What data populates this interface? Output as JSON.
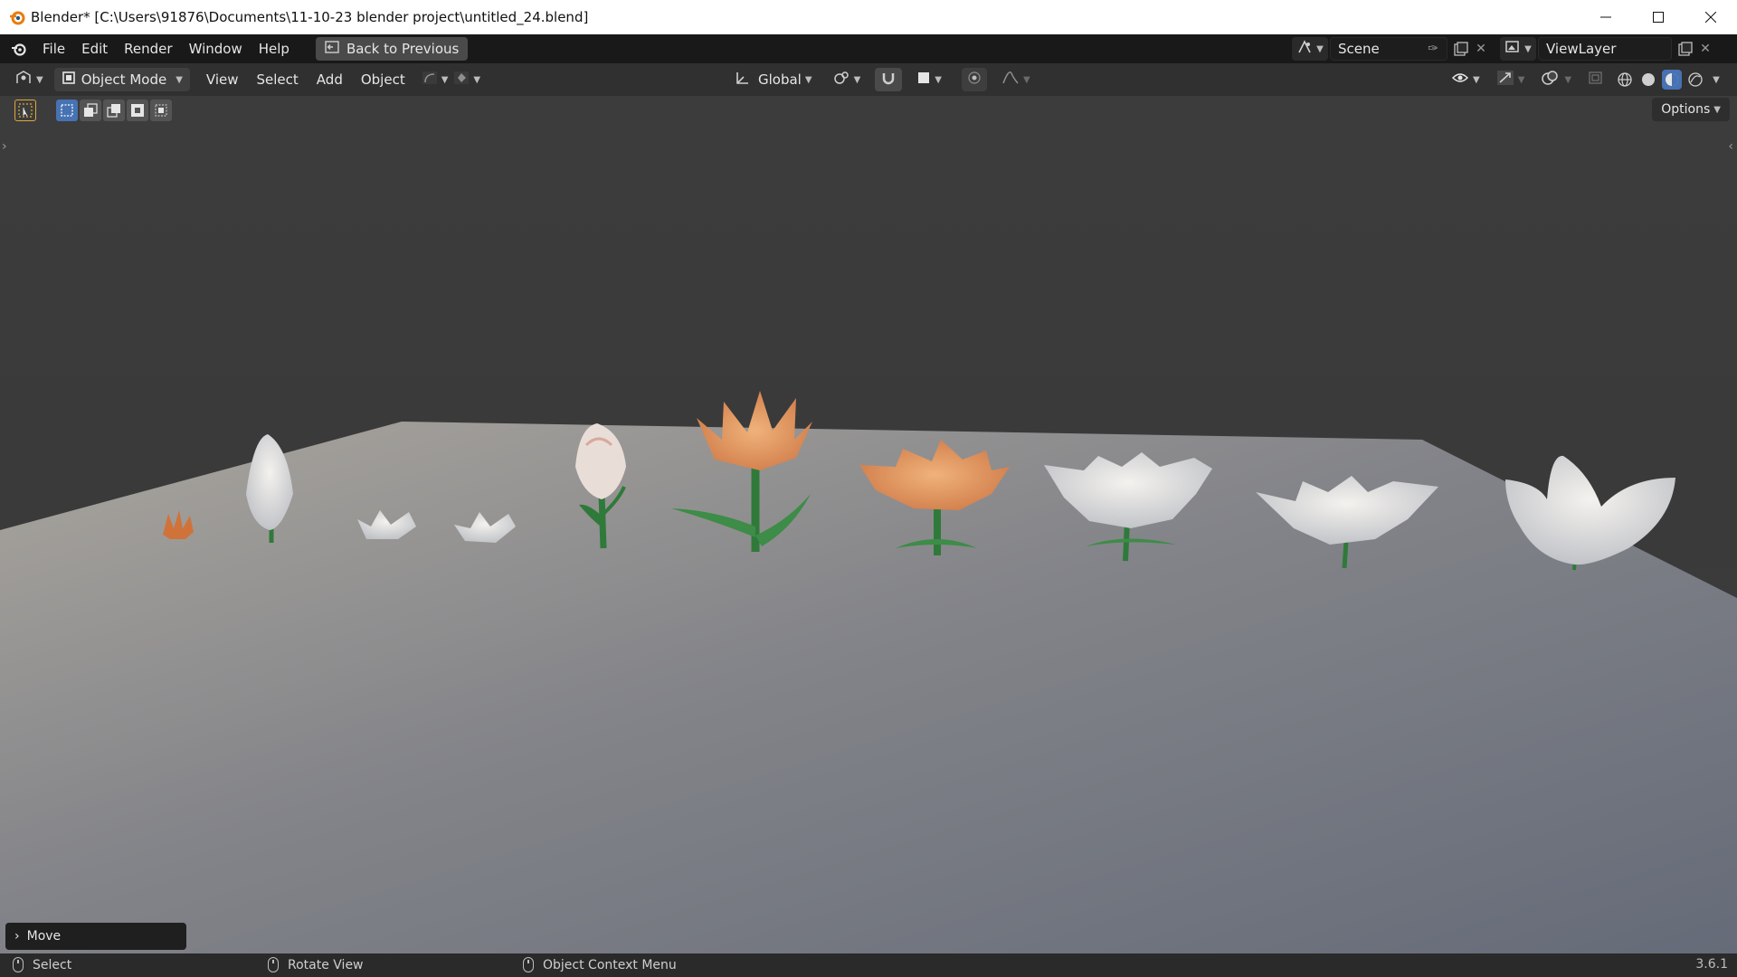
{
  "window": {
    "title": "Blender* [C:\\Users\\91876\\Documents\\11-10-23 blender project\\untitled_24.blend]"
  },
  "topbar": {
    "menus": [
      "File",
      "Edit",
      "Render",
      "Window",
      "Help"
    ],
    "back_button": "Back to Previous",
    "scene_label": "Scene",
    "view_layer_label": "ViewLayer"
  },
  "header": {
    "mode": "Object Mode",
    "menus": [
      "View",
      "Select",
      "Add",
      "Object"
    ],
    "transform_orientation": "Global"
  },
  "viewport": {
    "options_label": "Options",
    "last_operator": "Move",
    "colors": {
      "floor_light": "#a8a49c",
      "floor_dark": "#6e737e",
      "white_petal": "#e9e7e2",
      "orange_petal": "#d98b5f",
      "stem": "#2f7a3a"
    }
  },
  "statusbar": {
    "select": "Select",
    "rotate": "Rotate View",
    "context": "Object Context Menu",
    "version": "3.6.1"
  }
}
